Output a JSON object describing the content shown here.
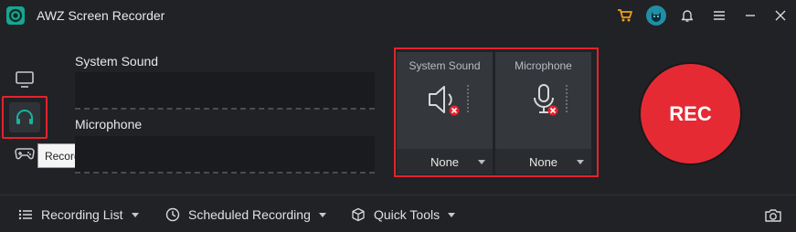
{
  "app": {
    "title": "AWZ Screen Recorder"
  },
  "titlebar": {
    "icons": [
      "cart-icon",
      "avatar-icon",
      "bell-icon",
      "menu-icon",
      "minimize-icon",
      "close-icon"
    ]
  },
  "nav": {
    "items": [
      "monitor-icon",
      "headphones-icon",
      "gamepad-icon"
    ],
    "tooltip": "Record Audio"
  },
  "sources": {
    "system_sound_label": "System Sound",
    "microphone_label": "Microphone"
  },
  "devices": {
    "system_sound": {
      "label": "System Sound",
      "value": "None"
    },
    "microphone": {
      "label": "Microphone",
      "value": "None"
    }
  },
  "rec": {
    "label": "REC"
  },
  "bottom": {
    "recording_list": "Recording List",
    "scheduled_recording": "Scheduled Recording",
    "quick_tools": "Quick Tools"
  },
  "colors": {
    "accent": "#e62a33",
    "background": "#202226",
    "highlight": "#e3232e"
  }
}
